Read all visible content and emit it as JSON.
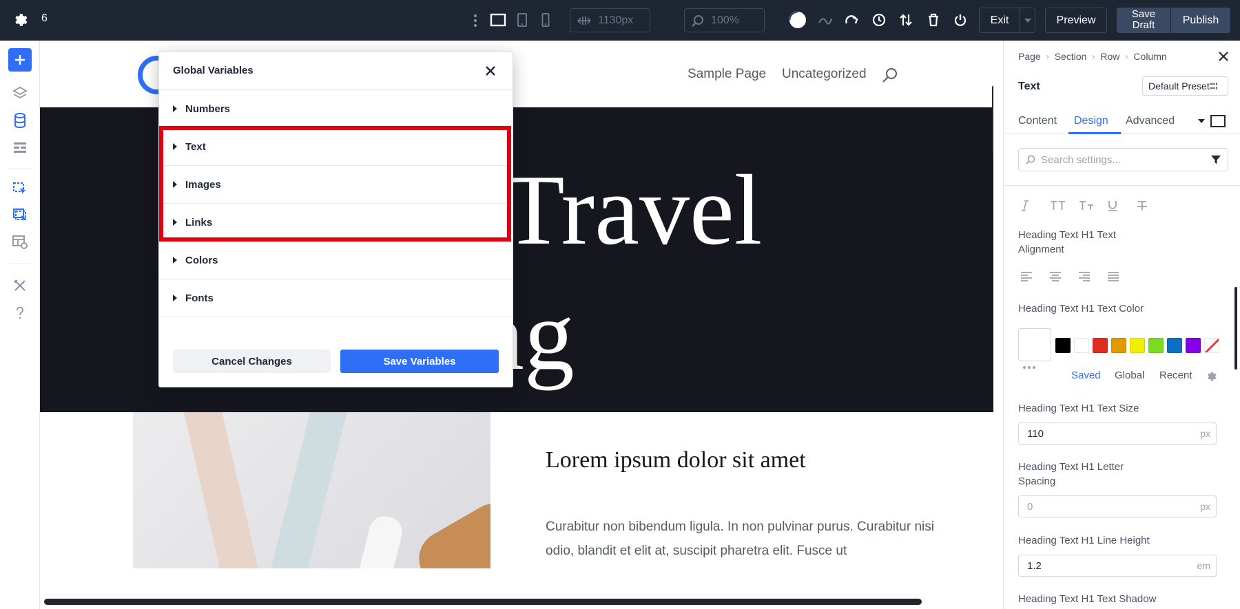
{
  "topbar": {
    "notification_count": "6",
    "width_value": "1130px",
    "zoom_value": "100%",
    "exit_label": "Exit",
    "preview_label": "Preview",
    "save_draft_line1": "Save",
    "save_draft_line2": "Draft",
    "publish_label": "Publish"
  },
  "site": {
    "nav": [
      "Sample Page",
      "Uncategorized"
    ],
    "hero_line1": "r Travel",
    "hero_line2": "ag",
    "section_title": "Lorem ipsum dolor sit amet",
    "section_body": "Curabitur non bibendum ligula. In non pulvinar purus. Curabitur nisi odio, blandit et elit at, suscipit pharetra elit. Fusce ut"
  },
  "modal": {
    "title": "Global Variables",
    "items": [
      {
        "label": "Numbers"
      },
      {
        "label": "Text"
      },
      {
        "label": "Images"
      },
      {
        "label": "Links"
      },
      {
        "label": "Colors"
      },
      {
        "label": "Fonts"
      }
    ],
    "cancel_label": "Cancel Changes",
    "save_label": "Save Variables"
  },
  "panel": {
    "breadcrumb": [
      "Page",
      "Section",
      "Row",
      "Column"
    ],
    "module_name": "Text",
    "preset_label": "Default Preset",
    "tabs": [
      {
        "label": "Content",
        "active": false
      },
      {
        "label": "Design",
        "active": true
      },
      {
        "label": "Advanced",
        "active": false
      }
    ],
    "search_placeholder": "Search settings...",
    "alignment_label": "Heading Text H1 Text Alignment",
    "color_label": "Heading Text H1 Text Color",
    "swatch_colors": [
      "#000000",
      "#ffffff",
      "#e02b20",
      "#e09900",
      "#edf000",
      "#7cda24",
      "#0c71c3",
      "#8300e9"
    ],
    "color_tabs": [
      {
        "label": "Saved",
        "active": true
      },
      {
        "label": "Global",
        "active": false
      },
      {
        "label": "Recent",
        "active": false
      }
    ],
    "size_label": "Heading Text H1 Text Size",
    "size_value": "110",
    "size_unit": "px",
    "letter_spacing_label": "Heading Text H1 Letter Spacing",
    "letter_spacing_value": "0",
    "letter_spacing_unit": "px",
    "line_height_label": "Heading Text H1 Line Height",
    "line_height_value": "1.2",
    "line_height_unit": "em",
    "shadow_label": "Heading Text H1 Text Shadow"
  },
  "colors": {
    "accent": "#2f6ff6",
    "topbar_bg": "#1e2533",
    "hero_bg": "#16161e",
    "highlight": "#e3000f"
  }
}
